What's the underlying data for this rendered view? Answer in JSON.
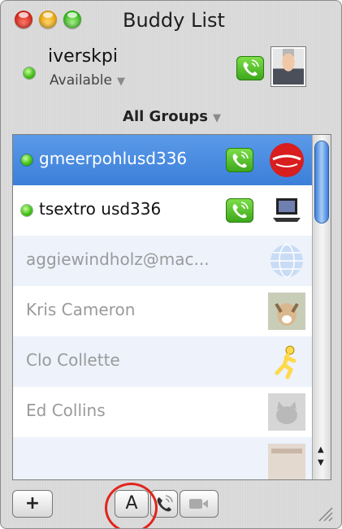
{
  "window": {
    "title": "Buddy List"
  },
  "me": {
    "name": "iverskpi",
    "status": "Available"
  },
  "group_selector": {
    "label": "All Groups"
  },
  "buddies": [
    {
      "name": "gmeerpohlusd336",
      "online": true,
      "selected": true,
      "has_phone": true,
      "avatar": "coca-cola-icon"
    },
    {
      "name": "tsextro usd336",
      "online": true,
      "selected": false,
      "has_phone": true,
      "avatar": "laptop-icon"
    },
    {
      "name": "aggiewindholz@mac...",
      "online": false,
      "selected": false,
      "has_phone": false,
      "avatar": "mac-globe-icon"
    },
    {
      "name": "Kris Cameron",
      "online": false,
      "selected": false,
      "has_phone": false,
      "avatar": "dog-photo"
    },
    {
      "name": "Clo Collette",
      "online": false,
      "selected": false,
      "has_phone": false,
      "avatar": "aim-running-man-icon"
    },
    {
      "name": "Ed Collins",
      "online": false,
      "selected": false,
      "has_phone": false,
      "avatar": "cat-photo"
    }
  ],
  "toolbar": {
    "add_label": "+",
    "text_label": "A"
  },
  "colors": {
    "selection": "#3b7fd9",
    "online": "#45c11a",
    "phone_green": "#3aa61a",
    "annotation_circle": "#e2241b"
  }
}
